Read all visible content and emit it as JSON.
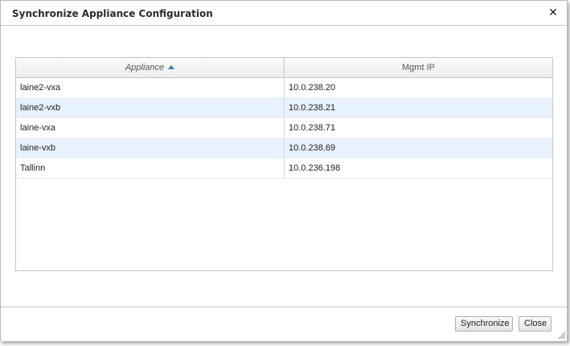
{
  "dialog": {
    "title": "Synchronize Appliance Configuration",
    "close_glyph": "✕"
  },
  "grid": {
    "columns": [
      {
        "label": "Appliance",
        "sorted": "ascending"
      },
      {
        "label": "Mgmt IP"
      }
    ],
    "rows": [
      {
        "appliance": "laine2-vxa",
        "ip": "10.0.238.20"
      },
      {
        "appliance": "laine2-vxb",
        "ip": "10.0.238.21"
      },
      {
        "appliance": "laine-vxa",
        "ip": "10.0.238.71"
      },
      {
        "appliance": "laine-vxb",
        "ip": "10.0.238.69"
      },
      {
        "appliance": "Tallinn",
        "ip": "10.0.236.198"
      }
    ]
  },
  "footer": {
    "synchronize_label": "Synchronize",
    "close_label": "Close"
  },
  "colors": {
    "sort_arrow": "#3a7cc7",
    "alt_row": "#e8f2fc"
  }
}
